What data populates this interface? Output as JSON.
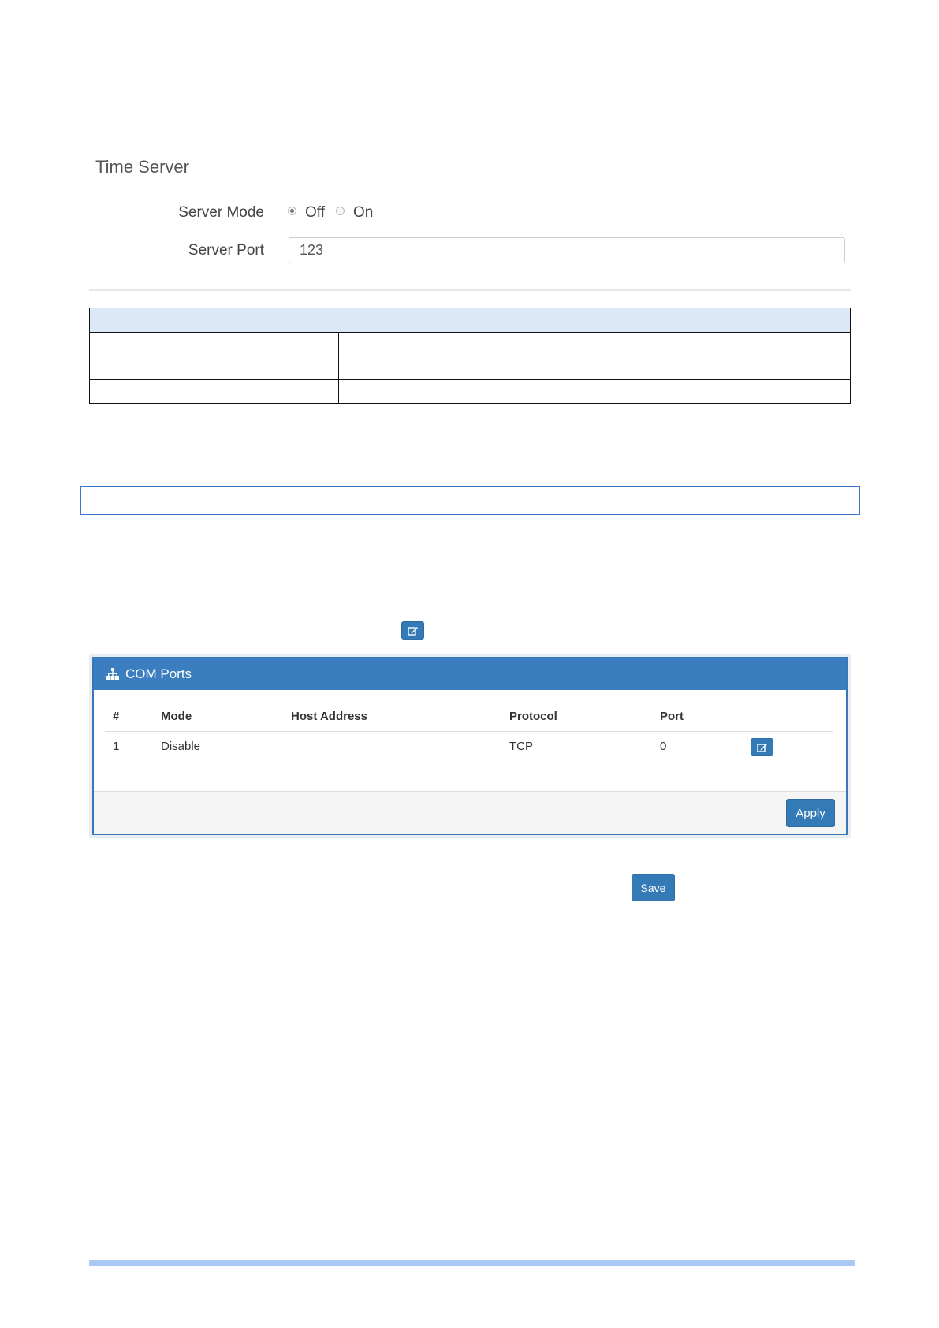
{
  "time_server": {
    "title": "Time Server",
    "server_mode_label": "Server Mode",
    "server_mode_options": [
      "Off",
      "On"
    ],
    "server_mode_selected": "Off",
    "server_port_label": "Server Port",
    "server_port_value": "123"
  },
  "com_ports": {
    "title": "COM Ports",
    "icon": "sitemap-icon",
    "columns": [
      "#",
      "Mode",
      "Host Address",
      "Protocol",
      "Port"
    ],
    "rows": [
      {
        "number": "1",
        "mode": "Disable",
        "host_address": "",
        "protocol": "TCP",
        "port": "0"
      }
    ],
    "apply_label": "Apply"
  },
  "save_label": "Save",
  "colors": {
    "primary": "#337ab7",
    "panel_header": "#3a7ebf",
    "table_header_fill": "#dce8f8",
    "bottom_bar": "#a9c8f3"
  }
}
